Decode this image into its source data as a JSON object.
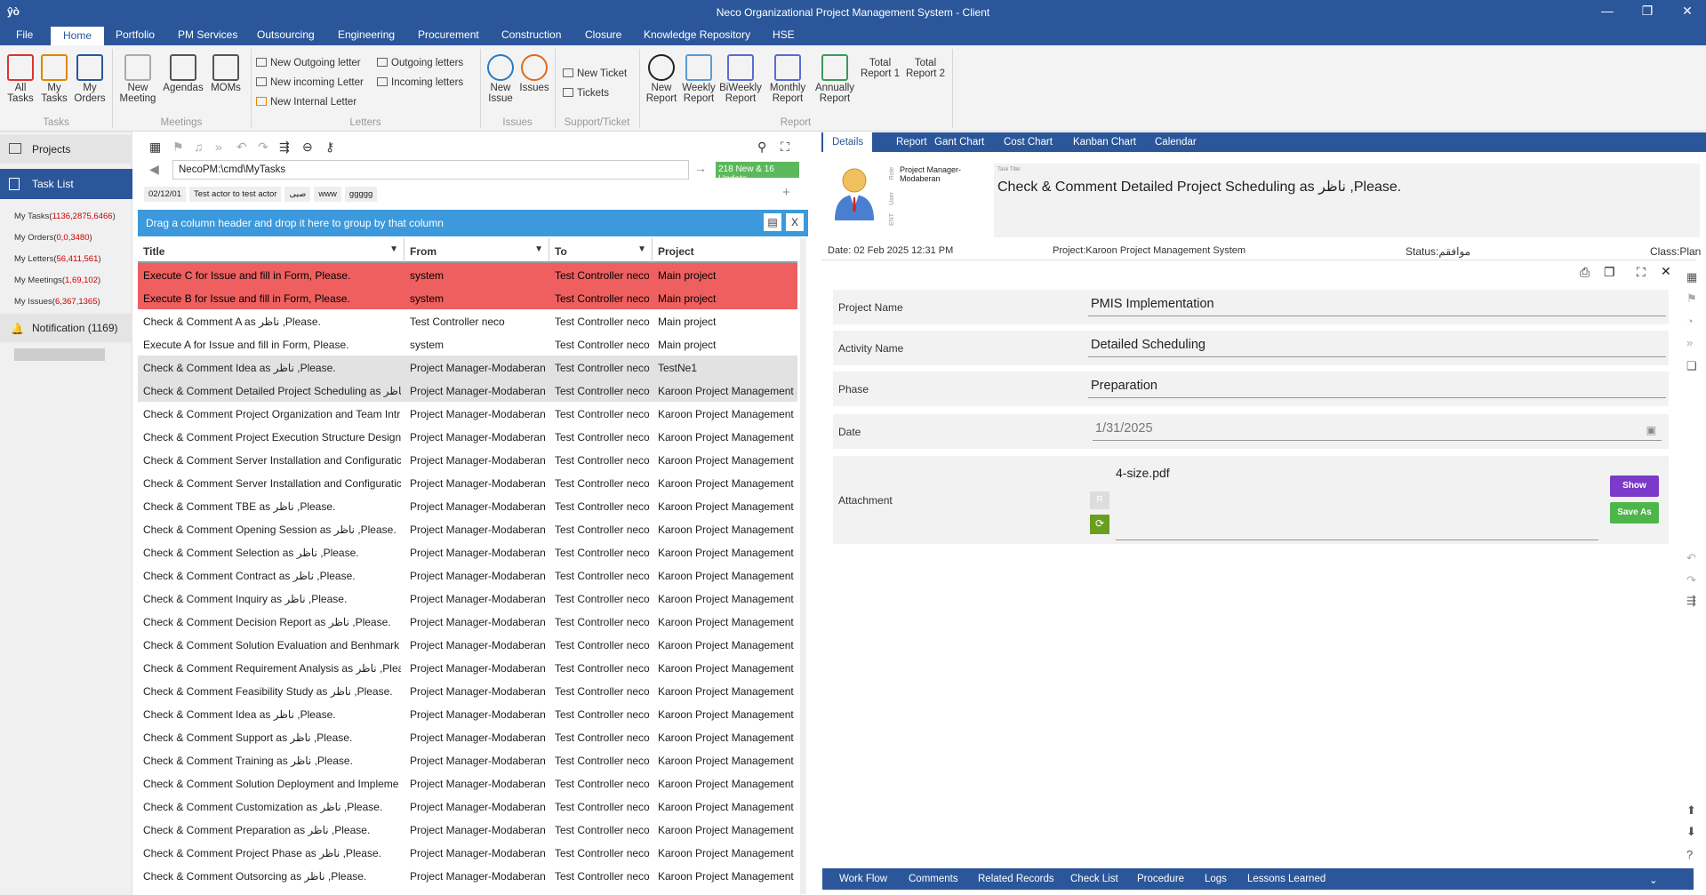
{
  "window": {
    "title": "Neco Organizational Project Management System - Client",
    "logo": "ŷò"
  },
  "menu": [
    "File",
    "Home",
    "Portfolio",
    "PM Services",
    "Outsourcing",
    "Engineering",
    "Procurement",
    "Construction",
    "Closure",
    "Knowledge Repository",
    "HSE"
  ],
  "ribbon": {
    "tasks": {
      "group": "Tasks",
      "all": "All\nTasks",
      "my": "My\nTasks",
      "orders": "My\nOrders"
    },
    "meetings": {
      "group": "Meetings",
      "new": "New\nMeeting",
      "agendas": "Agendas",
      "moms": "MOMs"
    },
    "letters": {
      "group": "Letters",
      "new_outgoing": "New Outgoing letter",
      "new_incoming": "New incoming Letter",
      "new_internal": "New Internal Letter",
      "outgoing": "Outgoing letters",
      "incoming": "Incoming letters"
    },
    "issues": {
      "group": "Issues",
      "new": "New\nIssue",
      "issues": "Issues"
    },
    "support": {
      "group": "Support/Ticket",
      "new_ticket": "New Ticket",
      "tickets": "Tickets"
    },
    "report": {
      "group": "Report",
      "new": "New\nReport",
      "weekly": "Weekly\nReport",
      "biweekly": "BiWeekly\nReport",
      "monthly": "Monthly\nReport",
      "annually": "Annually\nReport",
      "total1": "Total\nReport 1",
      "total2": "Total\nReport 2"
    }
  },
  "sidebar": {
    "projects": "Projects",
    "task_list": "Task List",
    "items": [
      {
        "label": "My Tasks(",
        "count": "1136,2875,6466",
        "end": ")"
      },
      {
        "label": "My Orders(",
        "count": "0,0,3480",
        "end": ")"
      },
      {
        "label": "My Letters(",
        "count": "56,411,561",
        "end": ")"
      },
      {
        "label": "My Meetings(",
        "count": "1,69,102",
        "end": ")"
      },
      {
        "label": "My Issues(",
        "count": "6,367,1365",
        "end": ")"
      }
    ],
    "notification": "Notification (1169)"
  },
  "middle": {
    "path": "NecoPM:\\cmd\\MyTasks",
    "update_badge": "218 New & 16 Update",
    "chips": [
      "02/12/01",
      "Test actor to test actor",
      "صبی",
      "www",
      "ggggg"
    ],
    "group_hint": "Drag a column header and drop it here to group by that column",
    "columns": [
      "Title",
      "From",
      "To",
      "Project"
    ],
    "rows": [
      {
        "t": "Execute C for Issue and fill in Form, Please.",
        "f": "system",
        "to": "Test Controller neco",
        "p": "Main project",
        "s": "red"
      },
      {
        "t": "Execute B for Issue and fill in Form, Please.",
        "f": "system",
        "to": "Test Controller neco",
        "p": "Main project",
        "s": "red"
      },
      {
        "t": "Check & Comment  A  as ناظر ,Please.",
        "f": "Test Controller neco",
        "to": "Test Controller neco",
        "p": "Main project",
        "s": ""
      },
      {
        "t": "Execute A for Issue and fill in Form, Please.",
        "f": "system",
        "to": "Test Controller neco",
        "p": "Main project",
        "s": ""
      },
      {
        "t": "Check & Comment  Idea  as ناظر ,Please.",
        "f": "Project Manager-Modaberan",
        "to": "Test Controller neco",
        "p": "TestNe1",
        "s": "sel"
      },
      {
        "t": "Check & Comment  Detailed Project Scheduling  as ناظر",
        "f": "Project Manager-Modaberan",
        "to": "Test Controller neco",
        "p": "Karoon Project Management S",
        "s": "sel"
      },
      {
        "t": "Check & Comment  Project Organization and Team Intr",
        "f": "Project Manager-Modaberan",
        "to": "Test Controller neco",
        "p": "Karoon Project Management S",
        "s": ""
      },
      {
        "t": "Check & Comment  Project Execution Structure Design",
        "f": "Project Manager-Modaberan",
        "to": "Test Controller neco",
        "p": "Karoon Project Management S",
        "s": ""
      },
      {
        "t": "Check & Comment  Server Installation and Configuratic",
        "f": "Project Manager-Modaberan",
        "to": "Test Controller neco",
        "p": "Karoon Project Management S",
        "s": ""
      },
      {
        "t": "Check & Comment  Server Installation and Configuratic",
        "f": "Project Manager-Modaberan",
        "to": "Test Controller neco",
        "p": "Karoon Project Management S",
        "s": ""
      },
      {
        "t": "Check & Comment  TBE  as ناظر ,Please.",
        "f": "Project Manager-Modaberan",
        "to": "Test Controller neco",
        "p": "Karoon Project Management S",
        "s": ""
      },
      {
        "t": "Check & Comment  Opening Session  as ناظر ,Please.",
        "f": "Project Manager-Modaberan",
        "to": "Test Controller neco",
        "p": "Karoon Project Management S",
        "s": ""
      },
      {
        "t": "Check & Comment  Selection  as ناظر ,Please.",
        "f": "Project Manager-Modaberan",
        "to": "Test Controller neco",
        "p": "Karoon Project Management S",
        "s": ""
      },
      {
        "t": "Check & Comment  Contract  as ناظر ,Please.",
        "f": "Project Manager-Modaberan",
        "to": "Test Controller neco",
        "p": "Karoon Project Management S",
        "s": ""
      },
      {
        "t": "Check & Comment  Inquiry  as ناظر ,Please.",
        "f": "Project Manager-Modaberan",
        "to": "Test Controller neco",
        "p": "Karoon Project Management S",
        "s": ""
      },
      {
        "t": "Check & Comment  Decision Report  as ناظر ,Please.",
        "f": "Project Manager-Modaberan",
        "to": "Test Controller neco",
        "p": "Karoon Project Management S",
        "s": ""
      },
      {
        "t": "Check & Comment  Solution Evaluation and Benhmark",
        "f": "Project Manager-Modaberan",
        "to": "Test Controller neco",
        "p": "Karoon Project Management S",
        "s": ""
      },
      {
        "t": "Check & Comment  Requirement Analysis  as ناظر ,Plea",
        "f": "Project Manager-Modaberan",
        "to": "Test Controller neco",
        "p": "Karoon Project Management S",
        "s": ""
      },
      {
        "t": "Check & Comment  Feasibility Study  as ناظر ,Please.",
        "f": "Project Manager-Modaberan",
        "to": "Test Controller neco",
        "p": "Karoon Project Management S",
        "s": ""
      },
      {
        "t": "Check & Comment  Idea  as ناظر ,Please.",
        "f": "Project Manager-Modaberan",
        "to": "Test Controller neco",
        "p": "Karoon Project Management S",
        "s": ""
      },
      {
        "t": "Check & Comment  Support  as ناظر ,Please.",
        "f": "Project Manager-Modaberan",
        "to": "Test Controller neco",
        "p": "Karoon Project Management S",
        "s": ""
      },
      {
        "t": "Check & Comment  Training  as ناظر ,Please.",
        "f": "Project Manager-Modaberan",
        "to": "Test Controller neco",
        "p": "Karoon Project Management S",
        "s": ""
      },
      {
        "t": "Check & Comment  Solution Deployment and Impleme",
        "f": "Project Manager-Modaberan",
        "to": "Test Controller neco",
        "p": "Karoon Project Management S",
        "s": ""
      },
      {
        "t": "Check & Comment  Customization  as ناظر ,Please.",
        "f": "Project Manager-Modaberan",
        "to": "Test Controller neco",
        "p": "Karoon Project Management S",
        "s": ""
      },
      {
        "t": "Check & Comment  Preparation  as ناظر ,Please.",
        "f": "Project Manager-Modaberan",
        "to": "Test Controller neco",
        "p": "Karoon Project Management S",
        "s": ""
      },
      {
        "t": "Check & Comment  Project Phase  as ناظر ,Please.",
        "f": "Project Manager-Modaberan",
        "to": "Test Controller neco",
        "p": "Karoon Project Management S",
        "s": ""
      },
      {
        "t": "Check & Comment  Outsorcing  as ناظر ,Please.",
        "f": "Project Manager-Modaberan",
        "to": "Test Controller neco",
        "p": "Karoon Project Management S",
        "s": ""
      }
    ]
  },
  "right": {
    "tabs": [
      "Details",
      "Report",
      "Gant Chart",
      "Cost Chart",
      "Kanban Chart",
      "Calendar"
    ],
    "role_label": "Role",
    "user_label": "User",
    "ent_label": "ENT",
    "role_value": "Project Manager-\nModaberan",
    "task_title_label": "Task Title:",
    "task_title": "Check & Comment  Detailed Project Scheduling  as ناظر ,Please.",
    "date": "Date:  02 Feb 2025 12:31 PM",
    "project": "Project:Karoon Project Management System",
    "status": "Status:موافقم",
    "class": "Class:Plan",
    "fields": [
      {
        "label": "Project Name",
        "value": "PMIS Implementation"
      },
      {
        "label": "Activity Name",
        "value": "Detailed Scheduling"
      },
      {
        "label": "Phase",
        "value": "Preparation"
      },
      {
        "label": "Date",
        "value": "1/31/2025"
      }
    ],
    "attachment": {
      "label": "Attachment",
      "file": "4-size.pdf",
      "r": "R",
      "show": "Show",
      "save_as": "Save As"
    },
    "bottom_tabs": [
      "Work Flow",
      "Comments",
      "Related Records",
      "Check List",
      "Procedure",
      "Logs",
      "Lessons Learned"
    ]
  }
}
